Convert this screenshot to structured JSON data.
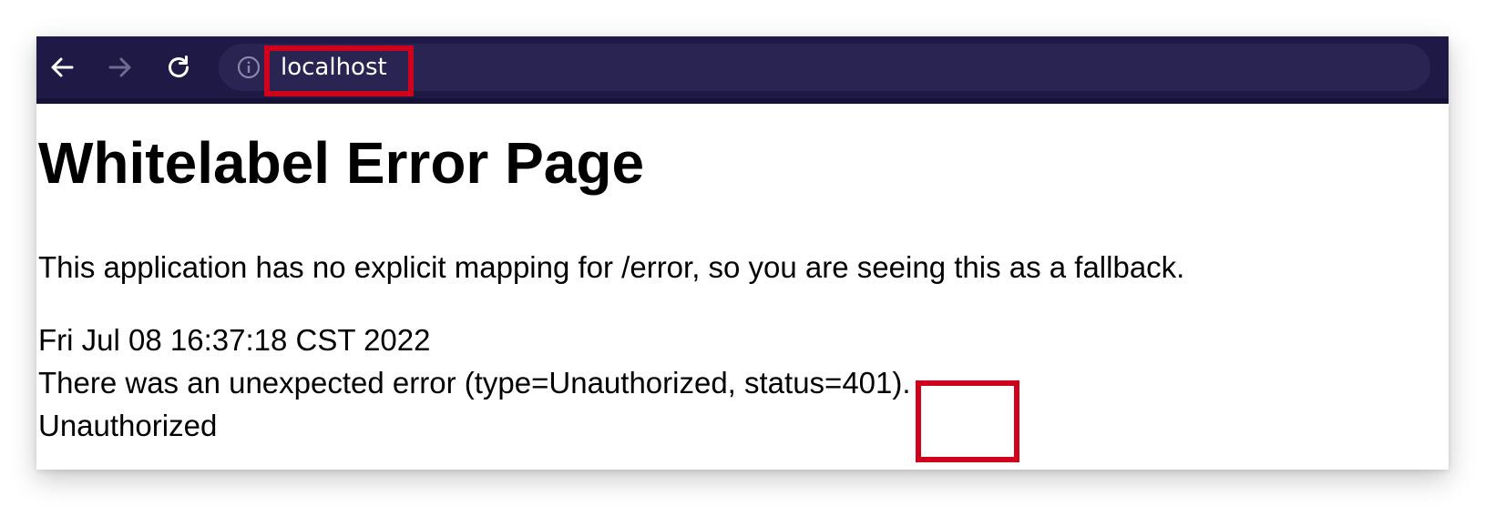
{
  "browser": {
    "url": "localhost",
    "colors": {
      "toolbar": "#1f1a45",
      "omnibox": "#2a2452",
      "highlight": "#d0021b"
    },
    "icons": {
      "back": "arrow-left-icon",
      "forward": "arrow-right-icon",
      "reload": "reload-icon",
      "info": "info-icon"
    }
  },
  "page": {
    "title": "Whitelabel Error Page",
    "message": "This application has no explicit mapping for /error, so you are seeing this as a fallback.",
    "timestamp": "Fri Jul 08 16:37:18 CST 2022",
    "error_detail": "There was an unexpected error (type=Unauthorized, status=401).",
    "status_text": "Unauthorized"
  }
}
